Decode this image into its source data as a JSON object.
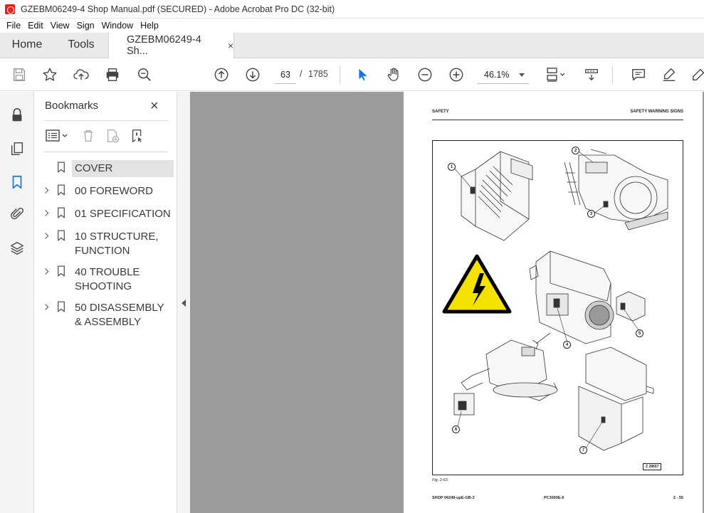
{
  "window": {
    "title": "GZEBM06249-4 Shop Manual.pdf (SECURED) - Adobe Acrobat Pro DC (32-bit)"
  },
  "menu": [
    "File",
    "Edit",
    "View",
    "Sign",
    "Window",
    "Help"
  ],
  "tabs": {
    "home": "Home",
    "tools": "Tools",
    "document": "GZEBM06249-4 Sh...",
    "close_glyph": "×"
  },
  "toolbar": {
    "current_page": "63",
    "separator": "/",
    "total_pages": "1785",
    "zoom": "46.1%",
    "icons": [
      "save-icon",
      "star-icon",
      "upload-icon",
      "print-icon",
      "search-zoom-icon",
      "page-up-icon",
      "page-down-icon",
      "select-arrow-icon",
      "hand-icon",
      "zoom-out-icon",
      "zoom-in-icon",
      "page-layout-icon",
      "scroll-mode-icon",
      "comment-icon",
      "highlight-icon",
      "sign-icon"
    ]
  },
  "rail": {
    "icons": [
      "lock-icon",
      "pages-icon",
      "bookmark-icon",
      "attachment-icon",
      "layers-icon"
    ]
  },
  "bookmarks": {
    "title": "Bookmarks",
    "close_glyph": "×",
    "items": [
      {
        "label": "COVER",
        "expandable": false,
        "selected": true
      },
      {
        "label": "00 FOREWORD",
        "expandable": true
      },
      {
        "label": "01 SPECIFICATION",
        "expandable": true
      },
      {
        "label": "10 STRUCTURE, FUNCTION",
        "expandable": true
      },
      {
        "label": "40 TROUBLE SHOOTING",
        "expandable": true
      },
      {
        "label": "50 DISASSEMBLY & ASSEMBLY",
        "expandable": true
      }
    ]
  },
  "page": {
    "header_left": "SAFETY",
    "header_right": "SAFETY WARNING SIGNS",
    "callouts": [
      "1",
      "2",
      "3",
      "4",
      "5",
      "6",
      "7"
    ],
    "z_code": "Z 28657",
    "caption": "Fig. 2-63",
    "footer_left": "SHOP 06249-upE-GB-3",
    "footer_mid": "PC3000E-6",
    "footer_right": "2 - 55"
  },
  "colors": {
    "warning_yellow": "#f4e100",
    "acrobat_red": "#e0251b",
    "select_blue": "#1473e6",
    "viewer_gray": "#9b9b9b"
  }
}
